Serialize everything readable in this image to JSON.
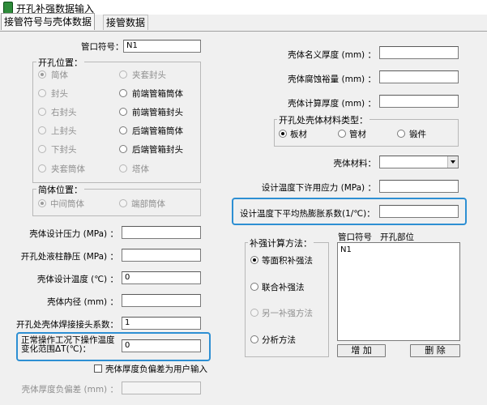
{
  "window": {
    "title": "开孔补强数据输入"
  },
  "tabs": [
    {
      "label": "接管符号与壳体数据"
    },
    {
      "label": "接管数据"
    }
  ],
  "nozzle": {
    "symbol_label": "管口符号：",
    "symbol_value": "N1"
  },
  "opening_position": {
    "title": "开孔位置：",
    "options": [
      "简体",
      "夹套封头",
      "封头",
      "前端管箱筒体",
      "右封头",
      "前端管箱封头",
      "上封头",
      "后端管箱筒体",
      "下封头",
      "后端管箱封头",
      "夹套筒体",
      "塔体"
    ]
  },
  "cylinder_position": {
    "title": "简体位置：",
    "options": [
      "中间筒体",
      "端部筒体"
    ]
  },
  "left_fields": {
    "design_pressure": {
      "label": "壳体设计压力 (MPa) ：",
      "value": ""
    },
    "liquid_pressure": {
      "label": "开孔处液柱静压 (MPa) ：",
      "value": ""
    },
    "design_temp": {
      "label": "壳体设计温度 (℃) ：",
      "value": "0"
    },
    "inner_diameter": {
      "label": "壳体内径 (mm) ：",
      "value": ""
    },
    "weld_coef": {
      "label": "开孔处壳体焊接接头系数：",
      "value": "1"
    },
    "temp_range": {
      "label": "正常操作工况下操作温度变化范围ΔT(℃)：",
      "value": "0"
    },
    "neg_tolerance": {
      "label": "壳体厚度负偏差 (mm) ：",
      "value": ""
    }
  },
  "user_input_check": {
    "label": "壳体厚度负偏差为用户输入"
  },
  "right_fields": {
    "nominal_thickness": {
      "label": "壳体名义厚度 (mm) ：",
      "value": ""
    },
    "corrosion": {
      "label": "壳体腐蚀裕量 (mm) ：",
      "value": ""
    },
    "calc_thickness": {
      "label": "壳体计算厚度 (mm) ：",
      "value": ""
    },
    "material": {
      "label": "壳体材料：",
      "value": ""
    },
    "allowable_stress": {
      "label": "设计温度下许用应力 (MPa) ：",
      "value": ""
    },
    "expansion_coef": {
      "label": "设计温度下平均热膨胀系数(1/℃)：",
      "value": ""
    }
  },
  "material_type": {
    "title": "开孔处壳体材料类型：",
    "options": [
      "板材",
      "管材",
      "锻件"
    ]
  },
  "reinforcement": {
    "title": "补强计算方法：",
    "options": [
      "等面积补强法",
      "联合补强法",
      "另一补强方法",
      "分析方法"
    ]
  },
  "nozzle_list": {
    "headers": [
      "管口符号",
      "开孔部位"
    ],
    "rows": [
      {
        "symbol": "N1",
        "part": ""
      }
    ]
  },
  "buttons": {
    "add": "增 加",
    "delete": "删 除"
  }
}
